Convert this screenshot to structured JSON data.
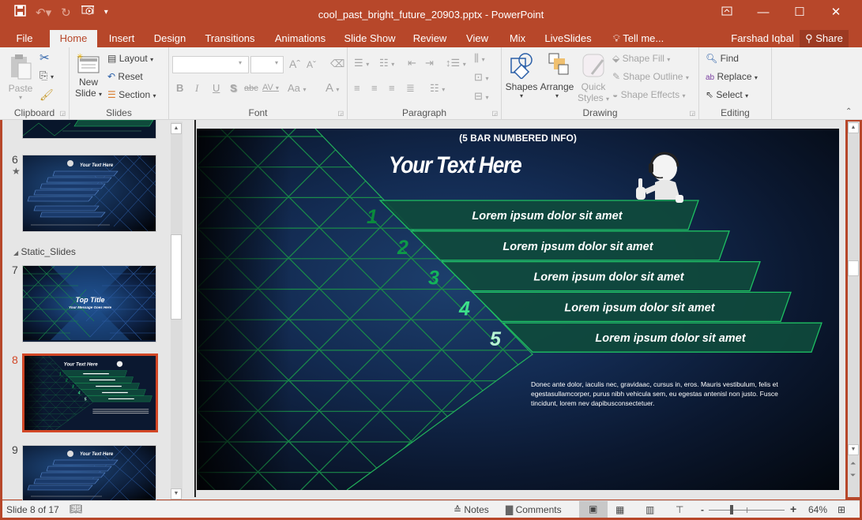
{
  "window": {
    "title": "cool_past_bright_future_20903.pptx - PowerPoint",
    "user": "Farshad Iqbal",
    "share_label": "Share",
    "controls": [
      "ribbon-display-options",
      "minimize",
      "maximize",
      "close"
    ]
  },
  "qat": {
    "icons": [
      "save-icon",
      "undo-icon",
      "redo-icon",
      "start-from-beginning-icon",
      "customize-qat-icon"
    ]
  },
  "tabs": [
    {
      "label": "File"
    },
    {
      "label": "Home",
      "active": true
    },
    {
      "label": "Insert"
    },
    {
      "label": "Design"
    },
    {
      "label": "Transitions"
    },
    {
      "label": "Animations"
    },
    {
      "label": "Slide Show"
    },
    {
      "label": "Review"
    },
    {
      "label": "View"
    },
    {
      "label": "Mix"
    },
    {
      "label": "LiveSlides"
    },
    {
      "label": "Tell me..."
    }
  ],
  "ribbon": {
    "clipboard": {
      "label": "Clipboard",
      "paste": "Paste"
    },
    "slides": {
      "label": "Slides",
      "new_slide_1": "New",
      "new_slide_2": "Slide",
      "layout": "Layout",
      "reset": "Reset",
      "section": "Section"
    },
    "font": {
      "label": "Font",
      "font_name": "",
      "font_size": "",
      "bold": "B",
      "italic": "I",
      "underline": "U",
      "shadow": "S",
      "strike": "abc",
      "spacing": "AV",
      "case": "Aa",
      "color": "A"
    },
    "paragraph": {
      "label": "Paragraph"
    },
    "drawing": {
      "label": "Drawing",
      "shapes": "Shapes",
      "arrange": "Arrange",
      "quick_styles_1": "Quick",
      "quick_styles_2": "Styles",
      "shape_fill": "Shape Fill",
      "shape_outline": "Shape Outline",
      "shape_effects": "Shape Effects"
    },
    "editing": {
      "label": "Editing",
      "find": "Find",
      "replace": "Replace",
      "select": "Select"
    }
  },
  "thumbnails": {
    "section_name": "Static_Slides",
    "items": [
      {
        "number": "6",
        "has_animation": true
      },
      {
        "number": "7",
        "title": "Top Title",
        "subtitle": "Your Message Goes Here"
      },
      {
        "number": "8",
        "selected": true
      },
      {
        "number": "9"
      }
    ]
  },
  "slide": {
    "header": "(5 BAR NUMBERED INFO)",
    "title": "Your Text Here",
    "bars": [
      {
        "number": "1",
        "text": "Lorem ipsum dolor sit amet"
      },
      {
        "number": "2",
        "text": "Lorem ipsum dolor sit amet"
      },
      {
        "number": "3",
        "text": "Lorem ipsum dolor sit amet"
      },
      {
        "number": "4",
        "text": "Lorem ipsum dolor sit amet"
      },
      {
        "number": "5",
        "text": "Lorem ipsum dolor sit amet"
      }
    ],
    "body": "Donec ante dolor, iaculis nec, gravidaac, cursus in, eros. Mauris vestibulum, felis et egestasullamcorper, purus nibh vehicula sem, eu egestas antenisl non justo. Fusce tincidunt, lorem nev dapibusconsectetuer.",
    "colors": {
      "bar_fill": "#0f4a3c",
      "bar_border": "#1ec062",
      "grid": "#1a8c4a"
    }
  },
  "status": {
    "slide_info": "Slide 8 of 17",
    "notes": "Notes",
    "comments": "Comments",
    "zoom": "64%",
    "zoom_fraction": 0.64
  }
}
